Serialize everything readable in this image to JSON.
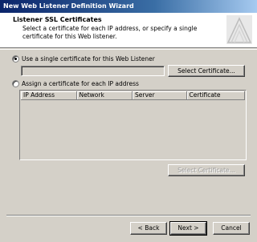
{
  "window": {
    "title": "New Web Listener Definition Wizard"
  },
  "header": {
    "title": "Listener SSL Certificates",
    "subtitle": "Select a certificate for each IP address, or specify a single certificate for this Web listener."
  },
  "options": {
    "single_cert": {
      "label": "Use a single certificate for this Web Listener",
      "selected": true
    },
    "per_ip": {
      "label": "Assign a certificate for each IP address",
      "selected": false
    }
  },
  "single_cert_field": {
    "value": ""
  },
  "buttons": {
    "select_certificate_top": "Select Certificate...",
    "select_certificate_bottom": "Select Certificate...",
    "back": "< Back",
    "next": "Next >",
    "cancel": "Cancel"
  },
  "table": {
    "columns": [
      "IP Address",
      "Network",
      "Server",
      "Certificate"
    ],
    "rows": []
  }
}
